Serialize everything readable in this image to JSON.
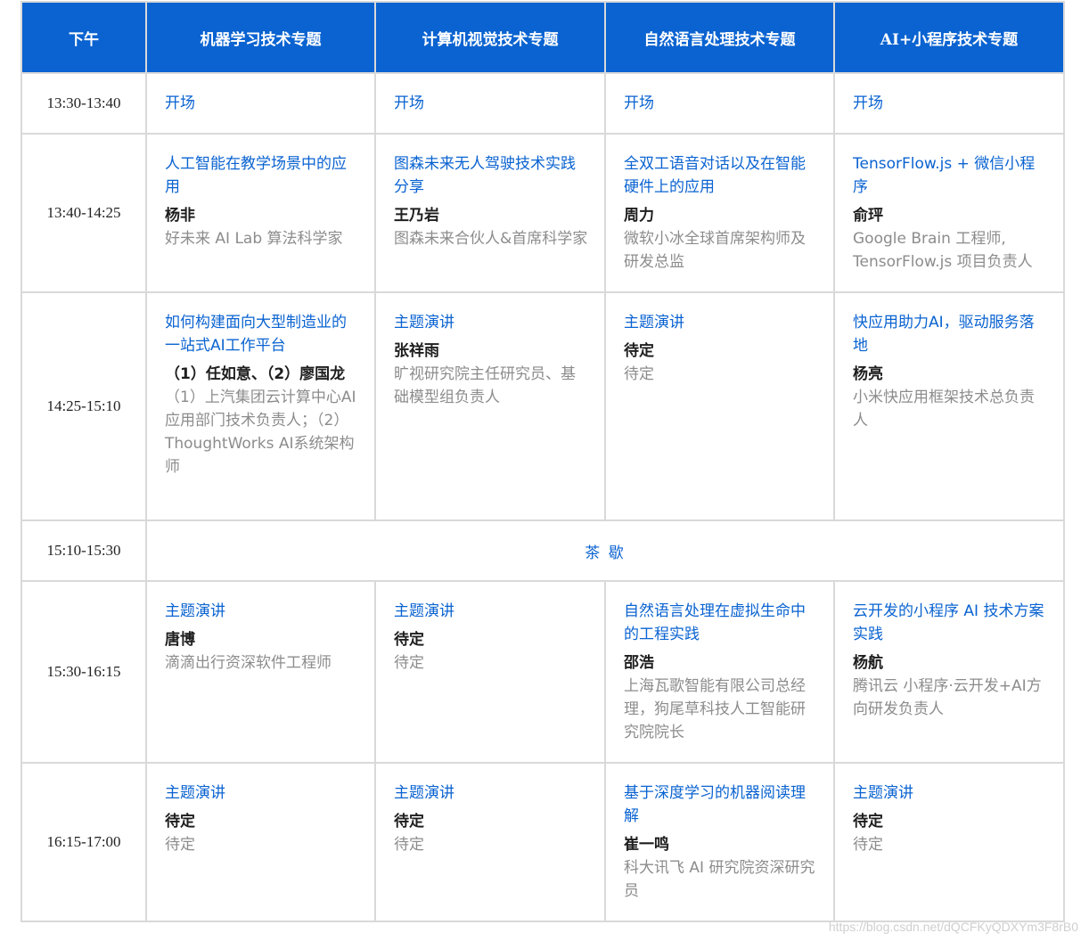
{
  "header": {
    "corner": "下午",
    "tracks": [
      "机器学习技术专题",
      "计算机视觉技术专题",
      "自然语言处理技术专题",
      "AI+小程序技术专题"
    ]
  },
  "rows": [
    {
      "time": "13:30-13:40",
      "cells": [
        {
          "title": "开场",
          "name": "",
          "role": ""
        },
        {
          "title": "开场",
          "name": "",
          "role": ""
        },
        {
          "title": "开场",
          "name": "",
          "role": ""
        },
        {
          "title": "开场",
          "name": "",
          "role": ""
        }
      ]
    },
    {
      "time": "13:40-14:25",
      "cells": [
        {
          "title": "人工智能在教学场景中的应用",
          "name": "杨非",
          "role": "好未来 AI Lab 算法科学家"
        },
        {
          "title": "图森未来无人驾驶技术实践分享",
          "name": "王乃岩",
          "role": "图森未来合伙人&首席科学家"
        },
        {
          "title": "全双工语音对话以及在智能硬件上的应用",
          "name": "周力",
          "role": "微软小冰全球首席架构师及研发总监"
        },
        {
          "title": "TensorFlow.js + 微信小程序",
          "name": "俞玶",
          "role": "Google Brain 工程师, TensorFlow.js 项目负责人"
        }
      ]
    },
    {
      "time": "14:25-15:10",
      "cells": [
        {
          "title": "如何构建面向大型制造业的一站式AI工作平台",
          "name": "（1）任如意、（2）廖国龙",
          "role": "（1）上汽集团云计算中心AI应用部门技术负责人；（2）ThoughtWorks AI系统架构师"
        },
        {
          "title": "主题演讲",
          "name": "张祥雨",
          "role": "旷视研究院主任研究员、基础模型组负责人"
        },
        {
          "title": "主题演讲",
          "name": "待定",
          "role": "待定"
        },
        {
          "title": "快应用助力AI，驱动服务落地",
          "name": "杨亮",
          "role": "小米快应用框架技术总负责人"
        }
      ]
    },
    {
      "time": "15:10-15:30",
      "break": "茶 歇"
    },
    {
      "time": "15:30-16:15",
      "cells": [
        {
          "title": "主题演讲",
          "name": "唐博",
          "role": "滴滴出行资深软件工程师"
        },
        {
          "title": "主题演讲",
          "name": "待定",
          "role": "待定"
        },
        {
          "title": "自然语言处理在虚拟生命中的工程实践",
          "name": "邵浩",
          "role": "上海瓦歌智能有限公司总经理，狗尾草科技人工智能研究院院长"
        },
        {
          "title": "云开发的小程序 AI 技术方案实践",
          "name": "杨航",
          "role": "腾讯云 小程序·云开发+AI方向研发负责人"
        }
      ]
    },
    {
      "time": "16:15-17:00",
      "cells": [
        {
          "title": "主题演讲",
          "name": "待定",
          "role": "待定"
        },
        {
          "title": "主题演讲",
          "name": "待定",
          "role": "待定"
        },
        {
          "title": "基于深度学习的机器阅读理解",
          "name": "崔一鸣",
          "role": "科大讯飞 AI 研究院资深研究员"
        },
        {
          "title": "主题演讲",
          "name": "待定",
          "role": "待定"
        }
      ]
    }
  ],
  "watermark": "https://blog.csdn.net/dQCFKyQDXYm3F8rB0",
  "colors": {
    "header_bg": "#0a63d1",
    "title": "#0a63d1",
    "name": "#1e1e1e",
    "role": "#8c8c8c",
    "border": "#d9d9d9"
  }
}
